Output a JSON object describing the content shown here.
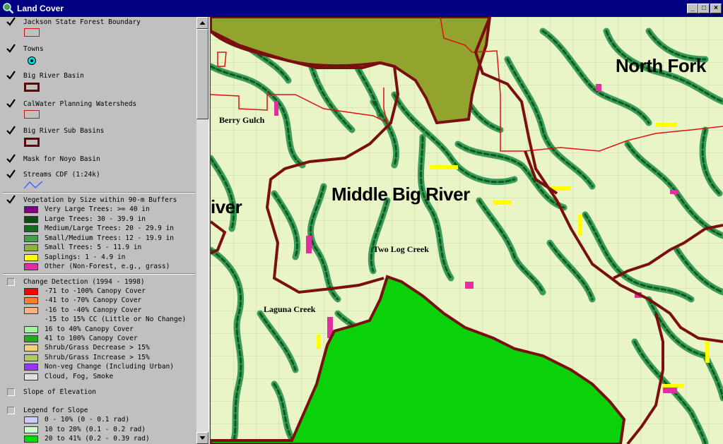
{
  "window": {
    "title": "Land Cover",
    "buttons": {
      "minimize": "_",
      "maximize": "□",
      "close": "×"
    }
  },
  "toc": {
    "layers": [
      {
        "name": "Jackson State Forest Boundary",
        "checked": true,
        "symbol": "red-outline-box"
      },
      {
        "name": "Towns",
        "checked": true,
        "symbol": "cyan-point"
      },
      {
        "name": "Big River Basin",
        "checked": true,
        "symbol": "dark-red-thick-box"
      },
      {
        "name": "CalWater Planning Watersheds",
        "checked": true,
        "symbol": "red-outline-box"
      },
      {
        "name": "Big River Sub Basins",
        "checked": true,
        "symbol": "dark-red-thick-box"
      },
      {
        "name": "Mask for Noyo Basin",
        "checked": true,
        "symbol": ""
      },
      {
        "name": "Streams CDF (1:24k)",
        "checked": true,
        "symbol": "blue-line"
      },
      {
        "name": "Vegetation by Size within 90-m Buffers",
        "checked": true,
        "symbol": "legend"
      },
      {
        "name": "Change Detection (1994 - 1998)",
        "checked": false,
        "symbol": "legend"
      },
      {
        "name": "Slope of Elevation",
        "checked": false,
        "symbol": ""
      },
      {
        "name": "Legend for Slope",
        "checked": false,
        "symbol": "legend"
      }
    ],
    "vegetation_legend": [
      {
        "label": "Very Large Trees: >= 40  in",
        "color": "#800080"
      },
      {
        "label": "Large Trees: 30 - 39.9 in",
        "color": "#0b4d12"
      },
      {
        "label": "Medium/Large Trees: 20 - 29.9 in",
        "color": "#156b1f"
      },
      {
        "label": "Small/Medium Trees: 12 - 19.9 in",
        "color": "#44a04a"
      },
      {
        "label": "Small Trees: 5 - 11.9 in",
        "color": "#8fb33a"
      },
      {
        "label": "Saplings: 1 - 4.9 in",
        "color": "#ffff00"
      },
      {
        "label": "Other (Non-Forest, e.g., grass)",
        "color": "#e0309f"
      }
    ],
    "change_legend": [
      {
        "label": "-71 to -100% Canopy Cover",
        "color": "#ff0000"
      },
      {
        "label": "-41 to -70% Canopy Cover",
        "color": "#ff7f27"
      },
      {
        "label": "-16 to -40% Canopy Cover",
        "color": "#ffb27f"
      },
      {
        "label": "-15 to 15% CC (Little or No Change)",
        "color": ""
      },
      {
        "label": "16 to 40% Canopy Cover",
        "color": "#a0f0a0"
      },
      {
        "label": "41 to 100% Canopy Cover",
        "color": "#22aa22"
      },
      {
        "label": "Shrub/Grass Decrease > 15%",
        "color": "#f3d27a"
      },
      {
        "label": "Shrub/Grass Increase > 15%",
        "color": "#b3c86a"
      },
      {
        "label": "Non-veg Change (Including Urban)",
        "color": "#9933ff"
      },
      {
        "label": "Cloud, Fog, Smoke",
        "color": "#e0e0e0"
      }
    ],
    "slope_legend": [
      {
        "label": "0 - 10% (0 - 0.1 rad)",
        "color": "#ccccff"
      },
      {
        "label": "10 to 20% (0.1 - 0.2 rad)",
        "color": "#ccffcc"
      },
      {
        "label": "20 to 41% (0.2 - 0.39 rad)",
        "color": "#00dd00"
      }
    ]
  },
  "map": {
    "labels": {
      "north_fork": "North Fork",
      "middle_big_river": "Middle Big River",
      "river_fragment": "iver",
      "berry_gulch": "Berry Gulch",
      "two_log_creek": "Two Log Creek",
      "laguna_creek": "Laguna Creek"
    },
    "colors": {
      "background": "#e9f5c6",
      "mask_olive": "#93a42e",
      "mask_green": "#0bd10b",
      "stream_outer": "#3c9d5a",
      "stream_inner": "#0d5a1e",
      "basin_boundary": "#7a0f0f",
      "watershed": "#e01010",
      "sapling": "#ffff00",
      "other": "#e0309f"
    }
  }
}
